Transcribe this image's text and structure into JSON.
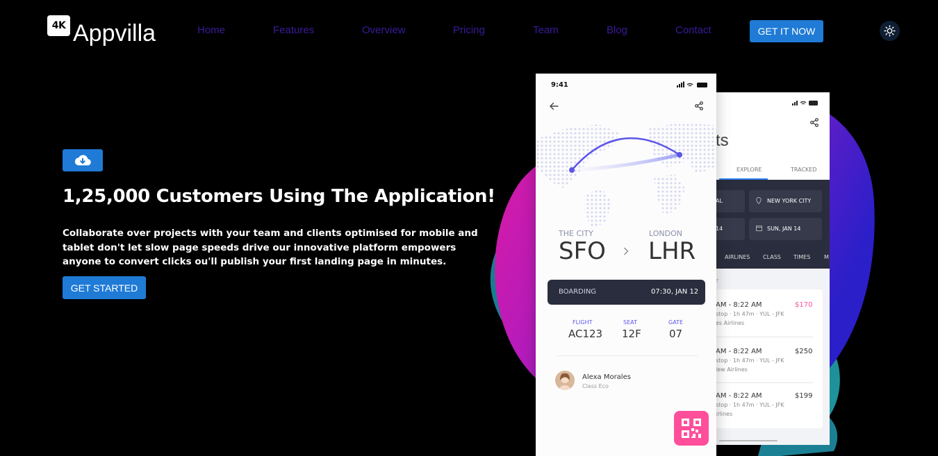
{
  "brand": {
    "badge": "4K",
    "name": "Appvilla"
  },
  "nav": {
    "links": [
      "Home",
      "Features",
      "Overview",
      "Pricing",
      "Team",
      "Blog",
      "Contact"
    ],
    "cta": "GET IT NOW"
  },
  "hero": {
    "title": "1,25,000 Customers Using The Application!",
    "description": "Collaborate over projects with your team and clients optimised for mobile and tablet don't let slow page speeds drive our innovative platform empowers anyone to convert clicks ou'll publish your first landing page in minutes.",
    "button": "GET STARTED"
  },
  "front_phone": {
    "time": "9:41",
    "from_label": "THE CITY",
    "from_code": "SFO",
    "to_label": "LONDON",
    "to_code": "LHR",
    "boarding_label": "BOARDING",
    "boarding_time": "07:30, JAN 12",
    "flight_label": "FLIGHT",
    "flight_value": "AC123",
    "seat_label": "SEAT",
    "seat_value": "12F",
    "gate_label": "GATE",
    "gate_value": "07",
    "passenger_name": "Alexa Morales",
    "passenger_class": "Class Eco"
  },
  "back_phone": {
    "title_fragment": "ts",
    "tabs": [
      "EXPLORE",
      "TRACKED"
    ],
    "field_left_1": "AL",
    "field_right_1": "NEW YORK CITY",
    "field_left_2": "14",
    "field_right_2": "SUN, JAN 14",
    "filters": [
      "AIRLINES",
      "CLASS",
      "TIMES",
      "M"
    ],
    "section_fragment": "T",
    "results": [
      {
        "time": "AM - 8:22 AM",
        "detail": "stop · 1h 47m · YUL - JFK",
        "airline": "es Airlines",
        "price": "$170"
      },
      {
        "time": "AM - 8:22 AM",
        "detail": "stop · 1h 47m · YUL - JFK",
        "airline": "lew Airlines",
        "price": "$250"
      },
      {
        "time": "AM - 8:22 AM",
        "detail": "stop · 1h 47m · YUL - JFK",
        "airline": "irlines",
        "price": "$199"
      }
    ]
  },
  "colors": {
    "accent": "#1f7bd6",
    "nav_link": "#3a1a9a",
    "price_highlight": "#ff4f9a",
    "qr": "#ff4f9a"
  },
  "icons": {
    "download": "cloud-download-icon",
    "theme": "sun-icon"
  }
}
